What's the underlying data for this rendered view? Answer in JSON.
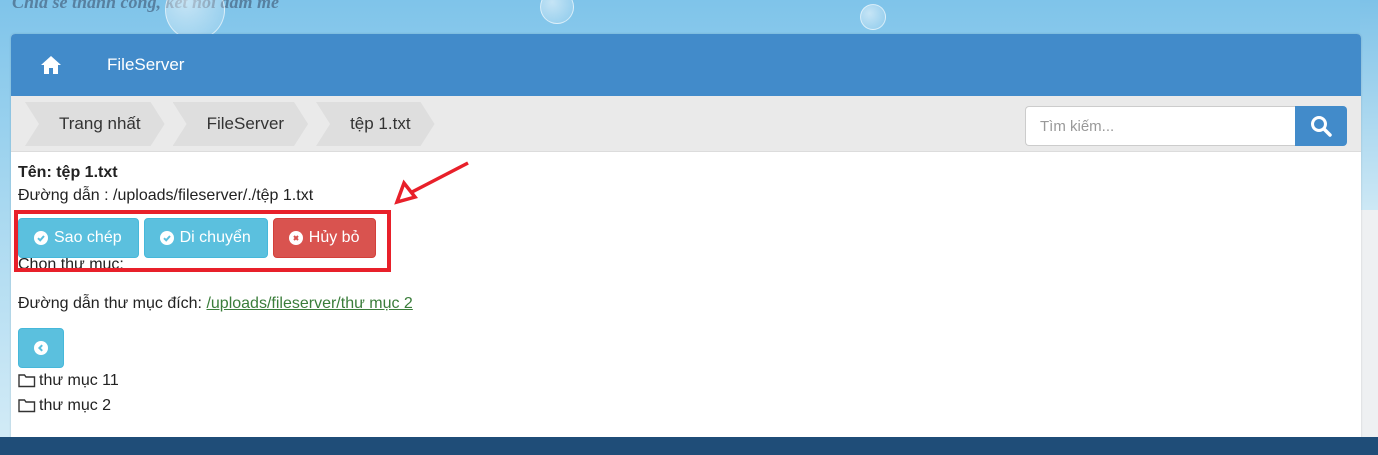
{
  "header": {
    "tagline": "Chia sẻ thành công, kết nối đam mê",
    "title": "FileServer"
  },
  "breadcrumb": {
    "items": [
      {
        "label": "Trang nhất"
      },
      {
        "label": "FileServer"
      },
      {
        "label": "tệp 1.txt"
      }
    ]
  },
  "search": {
    "placeholder": "Tìm kiếm..."
  },
  "file": {
    "name_line": "Tên: tệp 1.txt",
    "path_line": "Đường dẫn : /uploads/fileserver/./tệp 1.txt"
  },
  "actions": {
    "copy_label": "Sao chép",
    "move_label": "Di chuyển",
    "cancel_label": "Hủy bỏ"
  },
  "chooser": {
    "choose_label": "Chọn thư mục:",
    "dest_prefix": "Đường dẫn thư mục đích: ",
    "dest_link": "/uploads/fileserver/thư mục 2"
  },
  "folders": [
    {
      "label": "thư mục 11"
    },
    {
      "label": "thư mục 2"
    }
  ],
  "colors": {
    "primary": "#428bca",
    "info": "#5bc0de",
    "danger": "#d9534f",
    "annotation": "#e8202a",
    "footer": "#1f4d78"
  }
}
